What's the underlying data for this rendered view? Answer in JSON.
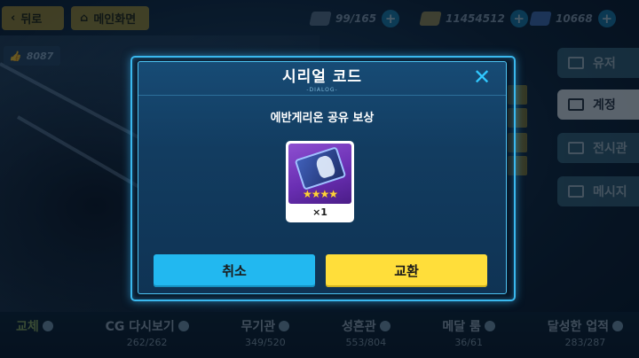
{
  "topbar": {
    "back_label": "뒤로",
    "home_label": "메인화면",
    "stamina": "99/165",
    "coins": "11454512",
    "crystals": "10668"
  },
  "likes": "8087",
  "side_tabs": [
    "유저",
    "계정",
    "전시관",
    "메시지"
  ],
  "bottom_bar": [
    {
      "label": "교체",
      "count": ""
    },
    {
      "label": "CG 다시보기",
      "count": "262/262"
    },
    {
      "label": "무기관",
      "count": "349/520"
    },
    {
      "label": "성흔관",
      "count": "553/804"
    },
    {
      "label": "메달 룸",
      "count": "36/61"
    },
    {
      "label": "달성한 업적",
      "count": "283/287"
    }
  ],
  "dialog": {
    "title": "시리얼 코드",
    "subtitle": "-DIALOG-",
    "close_icon": "close-icon",
    "reward_title": "에반게리온 공유 보상",
    "reward": {
      "stars": "★★★★",
      "quantity": "×1"
    },
    "cancel_label": "취소",
    "confirm_label": "교환"
  },
  "colors": {
    "accent_blue": "#22b8f0",
    "accent_yellow": "#ffde3a",
    "frame": "#3ab8ee"
  }
}
